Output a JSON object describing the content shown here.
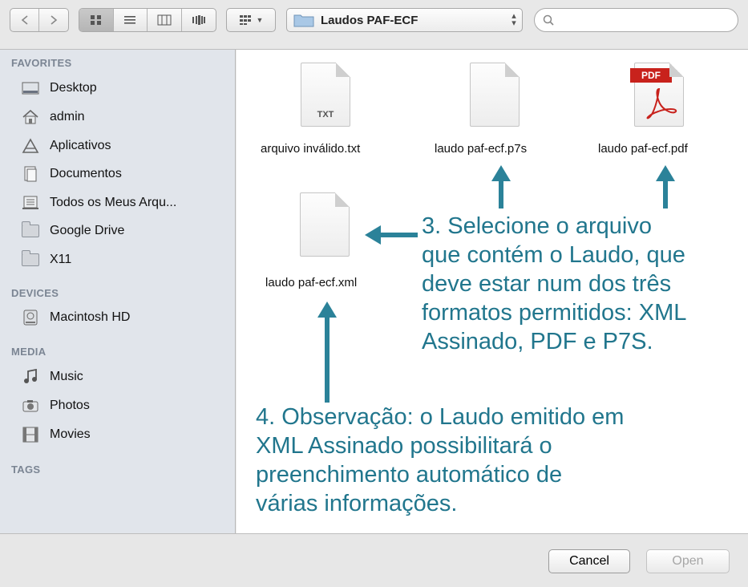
{
  "toolbar": {
    "back_icon": "chevron-left",
    "forward_icon": "chevron-right",
    "view_icons": [
      "icon-view",
      "list-view",
      "column-view",
      "coverflow-view"
    ],
    "arrange_icon": "arrange-grid",
    "location": "Laudos PAF-ECF",
    "search_placeholder": ""
  },
  "sidebar": {
    "favorites_header": "FAVORITES",
    "favorites": [
      {
        "label": "Desktop",
        "icon": "desktop-icon"
      },
      {
        "label": "admin",
        "icon": "home-icon"
      },
      {
        "label": "Aplicativos",
        "icon": "applications-icon"
      },
      {
        "label": "Documentos",
        "icon": "documents-icon"
      },
      {
        "label": "Todos os Meus Arqu...",
        "icon": "all-files-icon"
      },
      {
        "label": "Google Drive",
        "icon": "folder-icon"
      },
      {
        "label": "X11",
        "icon": "folder-icon"
      }
    ],
    "devices_header": "DEVICES",
    "devices": [
      {
        "label": "Macintosh HD",
        "icon": "hard-disk-icon"
      }
    ],
    "media_header": "MEDIA",
    "media": [
      {
        "label": "Music",
        "icon": "music-icon"
      },
      {
        "label": "Photos",
        "icon": "camera-icon"
      },
      {
        "label": "Movies",
        "icon": "film-icon"
      }
    ],
    "tags_header": "TAGS"
  },
  "files": [
    {
      "name": "arquivo inválido.txt",
      "badge": "TXT"
    },
    {
      "name": "laudo paf-ecf.p7s",
      "badge": ""
    },
    {
      "name": "laudo paf-ecf.pdf",
      "badge": "PDF"
    },
    {
      "name": "laudo paf-ecf.xml",
      "badge": ""
    }
  ],
  "annotations": {
    "note3": [
      "3. Selecione o arquivo",
      "que contém o Laudo, que",
      "deve estar num dos três",
      "formatos permitidos: XML",
      "Assinado, PDF e P7S."
    ],
    "note4": [
      "4. Observação: o Laudo emitido em",
      "XML Assinado possibilitará o",
      "preenchimento automático de",
      "várias informações."
    ],
    "color": "#21768d"
  },
  "buttons": {
    "cancel": "Cancel",
    "open": "Open"
  }
}
